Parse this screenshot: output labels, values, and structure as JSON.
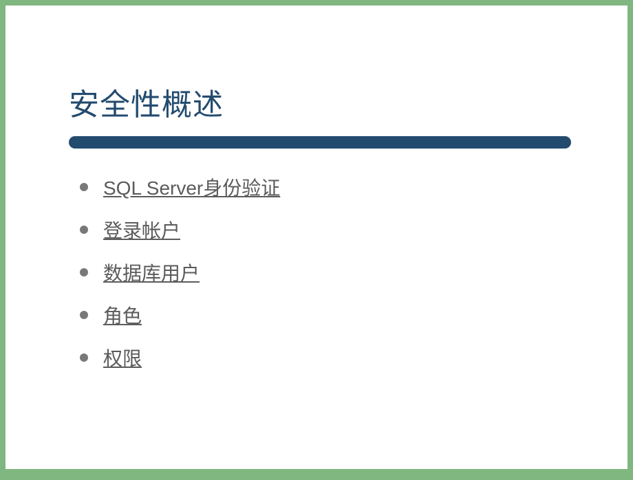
{
  "slide": {
    "title": "安全性概述",
    "items": [
      {
        "label": "SQL Server身份验证"
      },
      {
        "label": "登录帐户"
      },
      {
        "label": "数据库用户"
      },
      {
        "label": "角色"
      },
      {
        "label": "权限"
      }
    ]
  },
  "colors": {
    "background": "#80b780",
    "slide_bg": "#ffffff",
    "title": "#234b6e",
    "bar": "#234b6e",
    "bullet": "#787878",
    "link": "#5b5b5b"
  }
}
